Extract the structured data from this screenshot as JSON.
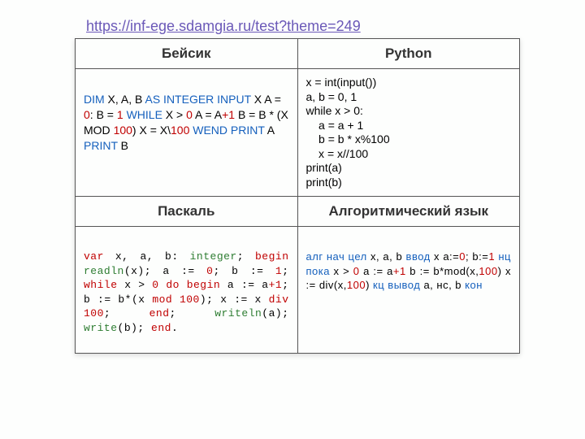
{
  "url": "https://inf-ege.sdamgia.ru/test?theme=249",
  "headers": {
    "basic": "Бейсик",
    "python": "Python",
    "pascal": "Паскаль",
    "alg": "Алгоритмический язык"
  },
  "basic": {
    "t0": "DIM",
    "t1": " X, A, B ",
    "t2": "AS INTEGER INPUT",
    "t3": " X A = ",
    "t4": "0",
    "t5": ": B = ",
    "t6": "1",
    "t7": " ",
    "t8": "WHILE",
    "t9": " X > ",
    "t10": "0",
    "t11": "    A = A",
    "t12": "+1",
    "t13": "    B = B * (X MOD ",
    "t14": "100",
    "t15": ")    X = X\\",
    "t16": "100",
    "t17": " ",
    "t18": "WEND PRINT",
    "t19": " A ",
    "t20": "PRINT",
    "t21": " B"
  },
  "python": "x = int(input())\na, b = 0, 1\nwhile x > 0:\n    a = a + 1\n    b = b * x%100\n    x = x//100\nprint(a)\nprint(b)",
  "pascal": {
    "p0": "var",
    "p1": "    x,    a,    b:    ",
    "p2": "integer",
    "p3": ";    ",
    "p4": "begin",
    "p5": "    ",
    "p6": "readln",
    "p7": "(x);    a := ",
    "p8": "0",
    "p9": "; b := ",
    "p10": "1",
    "p11": ";    ",
    "p12": "while",
    "p13": " x > ",
    "p14": "0",
    "p15": " ",
    "p16": "do",
    "p17": "    ",
    "p18": "begin",
    "p19": "        a := a",
    "p20": "+1",
    "p21": ";        b    :=    b*(x    ",
    "p22": "mod",
    "p23": "    ",
    "p24": "100",
    "p25": ");        x  :=  x  ",
    "p26": "div",
    "p27": "  ",
    "p28": "100",
    "p29": ";        ",
    "p30": "end",
    "p31": ";    ",
    "p32": "writeln",
    "p33": "(a); ",
    "p34": "write",
    "p35": "(b); ",
    "p36": "end",
    "p37": "."
  },
  "alg": {
    "a0": "алг нач цел",
    "a1": " x, a, b ",
    "a2": "ввод",
    "a3": " x a:=",
    "a4": "0",
    "a5": "; b:=",
    "a6": "1",
    "a7": " ",
    "a8": "нц пока",
    "a9": " x > ",
    "a10": "0",
    "a11": "   a := a",
    "a12": "+1",
    "a13": "   b := b*mod(x,",
    "a14": "100",
    "a15": ")     x   :=   div(x,",
    "a16": "100",
    "a17": ")   ",
    "a18": "кц",
    "a19": " ",
    "a20": "вывод",
    "a21": " a, нс, b ",
    "a22": "кон"
  }
}
